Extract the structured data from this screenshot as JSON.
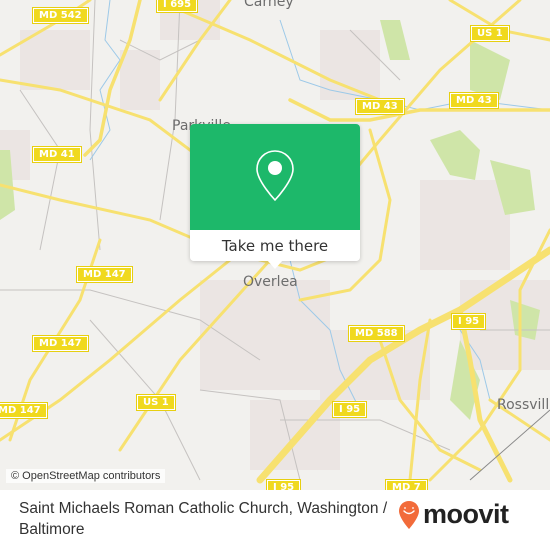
{
  "map": {
    "places": [
      {
        "name": "Carney",
        "id": "carney"
      },
      {
        "name": "Parkville",
        "id": "parkville"
      },
      {
        "name": "Overlea",
        "id": "overlea"
      },
      {
        "name": "Rossville",
        "id": "rossville"
      }
    ],
    "shields": [
      {
        "label": "MD 542"
      },
      {
        "label": "I 695"
      },
      {
        "label": "US 1"
      },
      {
        "label": "MD 43"
      },
      {
        "label": "MD 43"
      },
      {
        "label": "MD 41"
      },
      {
        "label": "MD 147"
      },
      {
        "label": "MD 147"
      },
      {
        "label": "MD 147"
      },
      {
        "label": "US 1"
      },
      {
        "label": "MD 588"
      },
      {
        "label": "I 95"
      },
      {
        "label": "I 95"
      },
      {
        "label": "I 95"
      },
      {
        "label": "MD 7"
      }
    ],
    "attribution": "© OpenStreetMap contributors"
  },
  "popup": {
    "icon": "map-pin-icon",
    "button_label": "Take me there",
    "color": "#1db86a"
  },
  "footer": {
    "title": "Saint Michaels Roman Catholic Church, Washington / Baltimore",
    "brand": "moovit",
    "brand_color": "#f26b3a"
  }
}
